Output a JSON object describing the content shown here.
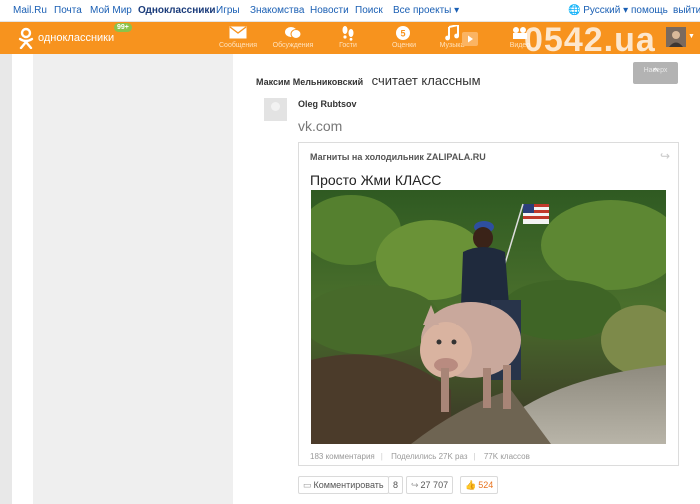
{
  "mail_bar": {
    "links": [
      {
        "label": "Mail.Ru",
        "active": false
      },
      {
        "label": "Почта",
        "active": false
      },
      {
        "label": "Мой Мир",
        "active": false
      },
      {
        "label": "Одноклассники",
        "active": true
      },
      {
        "label": "Игры",
        "active": false
      },
      {
        "label": "Знакомства",
        "active": false
      },
      {
        "label": "Новости",
        "active": false
      },
      {
        "label": "Поиск",
        "active": false
      },
      {
        "label": "Все проекты",
        "active": false
      }
    ],
    "language": "Русский",
    "help": "помощь",
    "logout": "выйти"
  },
  "ok_bar": {
    "logo_text": "одноклассники",
    "badge": "99+",
    "nav": [
      {
        "label": "Сообщения",
        "icon": "envelope-icon"
      },
      {
        "label": "Обсуждения",
        "icon": "discussions-icon"
      },
      {
        "label": "Гости",
        "icon": "footprints-icon"
      },
      {
        "label": "Оценки",
        "icon": "ratings-icon"
      },
      {
        "label": "Музыка",
        "icon": "music-icon"
      },
      {
        "label": "Видео",
        "icon": "video-icon"
      }
    ],
    "accent_color": "#f7931e"
  },
  "watermark": "0542.ua",
  "scroll_up": {
    "tooltip": "Наверх"
  },
  "feed_post": {
    "author": "Максим Мельниковский",
    "action": "считает классным",
    "sub_author": "Oleg Rubtsov",
    "domain": "vk.com",
    "card": {
      "source": "Магниты на холодильник ZALIPALA.RU",
      "title": "Просто Жми КЛАСС",
      "stats": [
        "183 комментария",
        "Поделились 27K раз",
        "77K классов"
      ]
    },
    "actions": {
      "comment_label": "Комментировать",
      "comment_count": "8",
      "share_count": "27 707",
      "like_count": "524"
    }
  }
}
